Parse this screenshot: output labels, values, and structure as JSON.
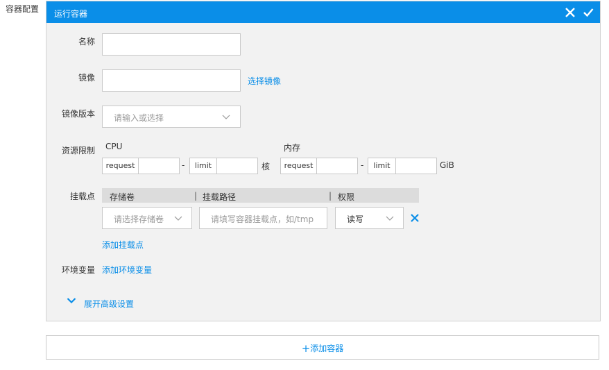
{
  "section_label": "容器配置",
  "panel": {
    "title": "运行容器"
  },
  "fields": {
    "name_label": "名称",
    "image_label": "镜像",
    "select_image_link": "选择镜像",
    "image_version_label": "镜像版本",
    "image_version_placeholder": "请输入或选择",
    "resource_label": "资源限制",
    "cpu_label": "CPU",
    "memory_label": "内存",
    "request_label": "request",
    "limit_label": "limit",
    "dash": "-",
    "cpu_unit": "核",
    "memory_unit": "GiB",
    "mount_label": "挂载点",
    "mount_columns": [
      "存储卷",
      "挂载路径",
      "权限"
    ],
    "volume_placeholder": "请选择存储卷",
    "mount_path_placeholder": "请填写容器挂载点，如/tmp",
    "permission_value": "读写",
    "add_mount_link": "添加挂载点",
    "env_label": "环境变量",
    "add_env_link": "添加环境变量",
    "advanced_link": "展开高级设置"
  },
  "add_container": {
    "plus": "+",
    "label": "添加容器"
  },
  "colors": {
    "accent": "#0a8ee8",
    "panel_bg": "#f2f2f2",
    "table_head_bg": "#dcdcdc"
  }
}
